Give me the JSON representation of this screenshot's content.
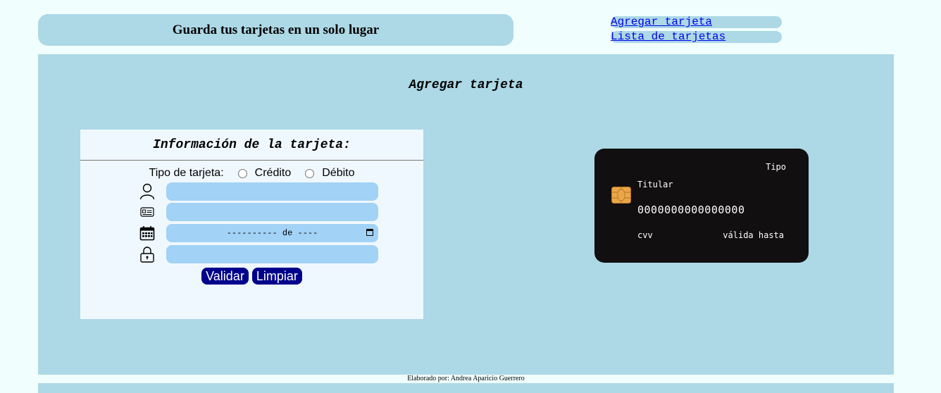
{
  "header": {
    "title": "Guarda tus tarjetas en un solo lugar"
  },
  "nav": {
    "add_card": "Agregar tarjeta",
    "card_list": "Lista de tarjetas"
  },
  "main": {
    "title": "Agregar tarjeta"
  },
  "form": {
    "heading": "Información de la tarjeta:",
    "card_type_label": "Tipo de tarjeta:",
    "credit_label": "Crédito",
    "debit_label": "Débito",
    "holder_value": "",
    "number_value": "",
    "expiry_placeholder": "---------- de ----",
    "cvv_value": "",
    "validate_label": "Validar",
    "clear_label": "Limpiar"
  },
  "card": {
    "type": "Tipo",
    "holder": "Titular",
    "number": "0000000000000000",
    "cvv": "cvv",
    "valid_until": "válida hasta"
  },
  "icons": {
    "holder": "user-icon",
    "number": "id-card-icon",
    "expiry": "calendar-icon",
    "cvv": "lock-icon",
    "chip": "card-chip-icon"
  },
  "colors": {
    "panel": "#add8e6",
    "page_bg": "#f0fffe",
    "form_bg": "#f0f8ff",
    "input_bg": "#a2d2f5",
    "button_bg": "#00008b",
    "card_bg": "#110f10"
  },
  "footer": {
    "credit": "Elaborado por: Andrea Aparicio Guerrero"
  }
}
